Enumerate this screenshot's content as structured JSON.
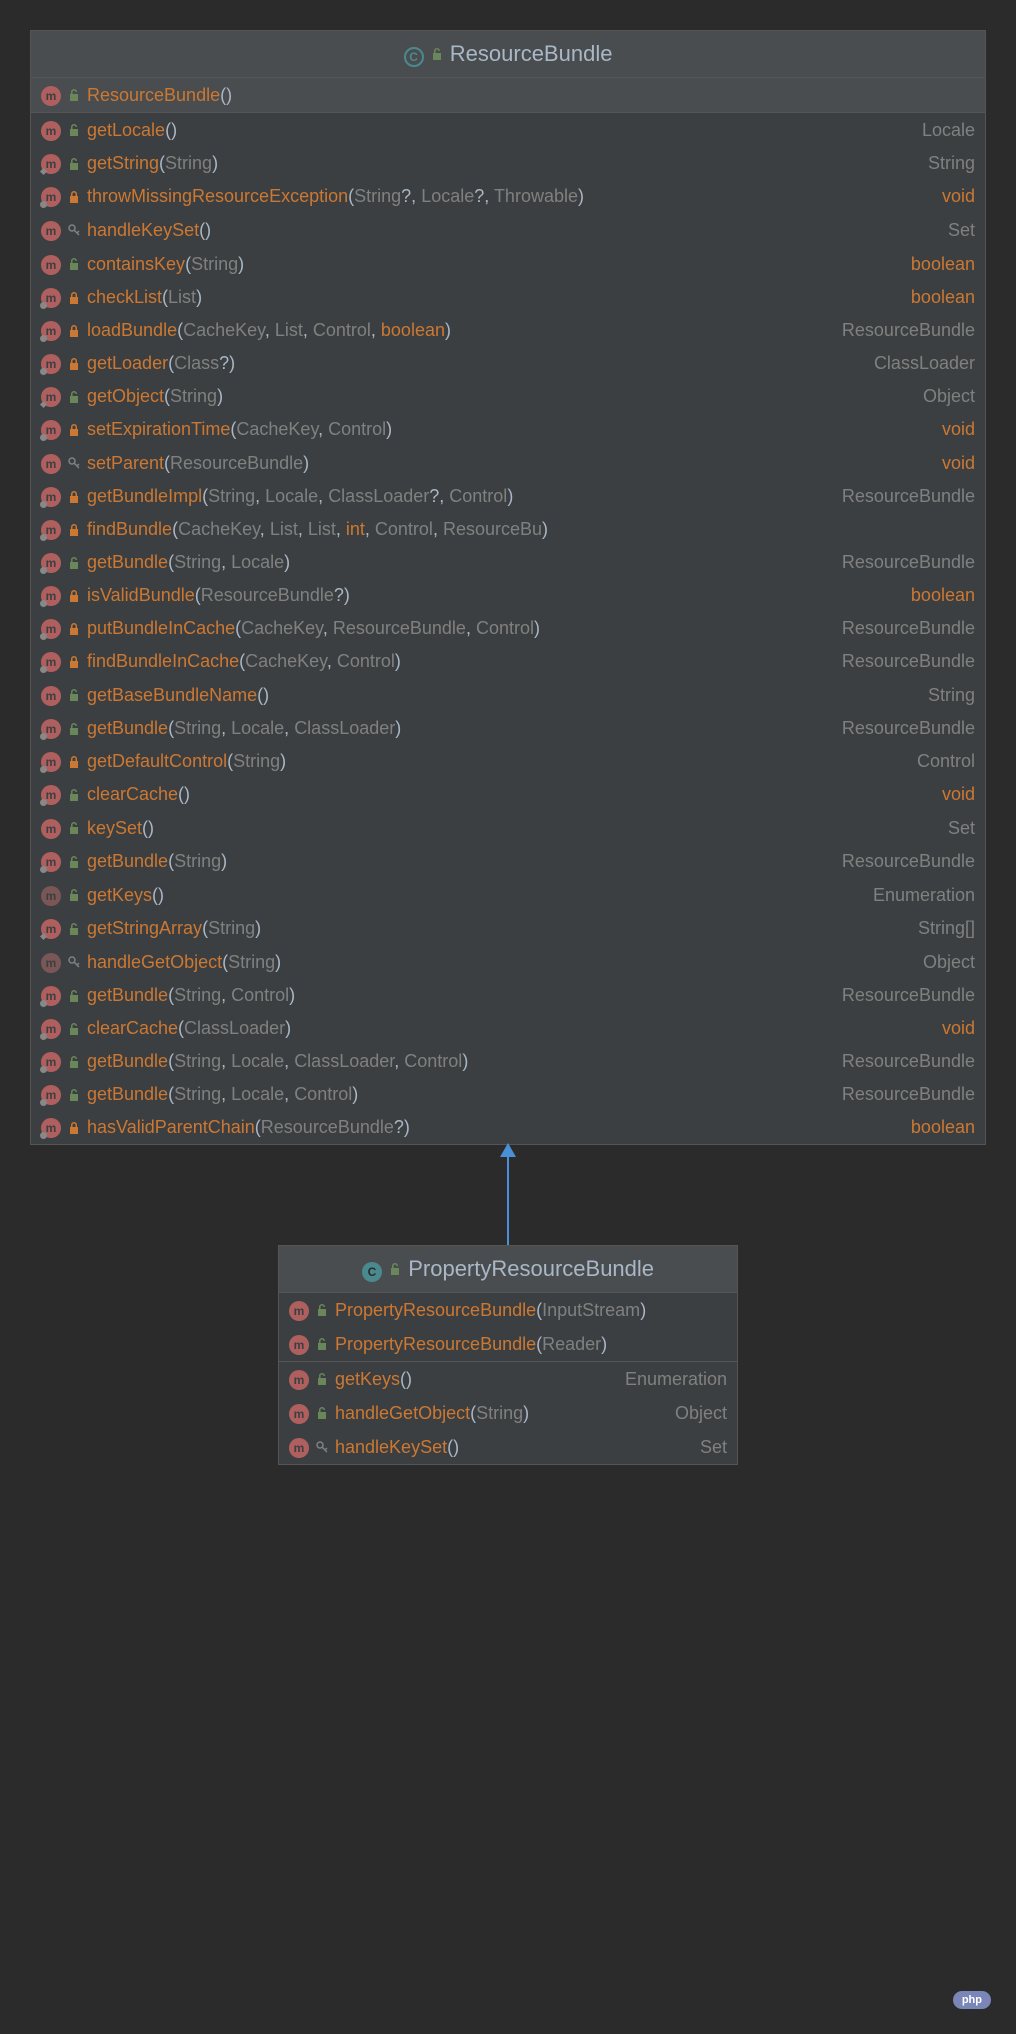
{
  "parent": {
    "title": "ResourceBundle",
    "constructors": [
      {
        "badge": "m",
        "mod": "unlock",
        "static": false,
        "name": "ResourceBundle",
        "params": [],
        "ret": "",
        "highlighted": true
      }
    ],
    "methods": [
      {
        "badge": "m",
        "mod": "unlock",
        "static": false,
        "name": "getLocale",
        "params": [],
        "ret": "Locale",
        "retKw": false
      },
      {
        "badge": "m",
        "mod": "unlock",
        "static": false,
        "final": true,
        "name": "getString",
        "params": [
          {
            "t": "String"
          }
        ],
        "ret": "String",
        "retKw": false
      },
      {
        "badge": "m",
        "mod": "lock",
        "static": true,
        "name": "throwMissingResourceException",
        "params": [
          {
            "t": "String",
            "q": true
          },
          {
            "t": "Locale",
            "q": true
          },
          {
            "t": "Throwable"
          }
        ],
        "ret": "void",
        "retKw": true
      },
      {
        "badge": "m",
        "mod": "key",
        "static": false,
        "name": "handleKeySet",
        "params": [],
        "ret": "Set<String>",
        "retKw": false
      },
      {
        "badge": "m",
        "mod": "unlock",
        "static": false,
        "name": "containsKey",
        "params": [
          {
            "t": "String"
          }
        ],
        "ret": "boolean",
        "retKw": true
      },
      {
        "badge": "m",
        "mod": "lock",
        "static": true,
        "name": "checkList",
        "params": [
          {
            "t": "List<?>"
          }
        ],
        "ret": "boolean",
        "retKw": true
      },
      {
        "badge": "m",
        "mod": "lock",
        "static": true,
        "name": "loadBundle",
        "params": [
          {
            "t": "CacheKey"
          },
          {
            "t": "List<String>"
          },
          {
            "t": "Control"
          },
          {
            "t": "boolean",
            "kw": true
          }
        ],
        "ret": "ResourceBundle",
        "retKw": false
      },
      {
        "badge": "m",
        "mod": "lock",
        "static": true,
        "name": "getLoader",
        "params": [
          {
            "t": "Class<?>",
            "q": true
          }
        ],
        "ret": "ClassLoader",
        "retKw": false
      },
      {
        "badge": "m",
        "mod": "unlock",
        "static": false,
        "final": true,
        "name": "getObject",
        "params": [
          {
            "t": "String"
          }
        ],
        "ret": "Object",
        "retKw": false
      },
      {
        "badge": "m",
        "mod": "lock",
        "static": true,
        "name": "setExpirationTime",
        "params": [
          {
            "t": "CacheKey"
          },
          {
            "t": "Control"
          }
        ],
        "ret": "void",
        "retKw": true
      },
      {
        "badge": "m",
        "mod": "key",
        "static": false,
        "name": "setParent",
        "params": [
          {
            "t": "ResourceBundle"
          }
        ],
        "ret": "void",
        "retKw": true
      },
      {
        "badge": "m",
        "mod": "lock",
        "static": true,
        "name": "getBundleImpl",
        "params": [
          {
            "t": "String"
          },
          {
            "t": "Locale"
          },
          {
            "t": "ClassLoader",
            "q": true
          },
          {
            "t": "Control"
          }
        ],
        "ret": "ResourceBundle",
        "retKw": false
      },
      {
        "badge": "m",
        "mod": "lock",
        "static": true,
        "name": "findBundle",
        "params": [
          {
            "t": "CacheKey"
          },
          {
            "t": "List<Locale>"
          },
          {
            "t": "List<String>"
          },
          {
            "t": "int",
            "kw": true
          },
          {
            "t": "Control"
          },
          {
            "t": "ResourceBu"
          }
        ],
        "ret": "",
        "retKw": false
      },
      {
        "badge": "m",
        "mod": "unlock",
        "static": true,
        "name": "getBundle",
        "params": [
          {
            "t": "String"
          },
          {
            "t": "Locale"
          }
        ],
        "ret": "ResourceBundle",
        "retKw": false
      },
      {
        "badge": "m",
        "mod": "lock",
        "static": true,
        "name": "isValidBundle",
        "params": [
          {
            "t": "ResourceBundle",
            "q": true
          }
        ],
        "ret": "boolean",
        "retKw": true
      },
      {
        "badge": "m",
        "mod": "lock",
        "static": true,
        "name": "putBundleInCache",
        "params": [
          {
            "t": "CacheKey"
          },
          {
            "t": "ResourceBundle"
          },
          {
            "t": "Control"
          }
        ],
        "ret": "ResourceBundle",
        "retKw": false
      },
      {
        "badge": "m",
        "mod": "lock",
        "static": true,
        "name": "findBundleInCache",
        "params": [
          {
            "t": "CacheKey"
          },
          {
            "t": "Control"
          }
        ],
        "ret": "ResourceBundle",
        "retKw": false
      },
      {
        "badge": "m",
        "mod": "unlock",
        "static": false,
        "name": "getBaseBundleName",
        "params": [],
        "ret": "String",
        "retKw": false
      },
      {
        "badge": "m",
        "mod": "unlock",
        "static": true,
        "name": "getBundle",
        "params": [
          {
            "t": "String"
          },
          {
            "t": "Locale"
          },
          {
            "t": "ClassLoader"
          }
        ],
        "ret": "ResourceBundle",
        "retKw": false
      },
      {
        "badge": "m",
        "mod": "lock",
        "static": true,
        "name": "getDefaultControl",
        "params": [
          {
            "t": "String"
          }
        ],
        "ret": "Control",
        "retKw": false
      },
      {
        "badge": "m",
        "mod": "unlock",
        "static": true,
        "name": "clearCache",
        "params": [],
        "ret": "void",
        "retKw": true
      },
      {
        "badge": "m",
        "mod": "unlock",
        "static": false,
        "name": "keySet",
        "params": [],
        "ret": "Set<String>",
        "retKw": false
      },
      {
        "badge": "m",
        "mod": "unlock",
        "static": true,
        "name": "getBundle",
        "params": [
          {
            "t": "String"
          }
        ],
        "ret": "ResourceBundle",
        "retKw": false
      },
      {
        "badge": "m",
        "ab": true,
        "mod": "unlock",
        "static": false,
        "name": "getKeys",
        "params": [],
        "ret": "Enumeration<String>",
        "retKw": false
      },
      {
        "badge": "m",
        "mod": "unlock",
        "static": false,
        "final": true,
        "name": "getStringArray",
        "params": [
          {
            "t": "String"
          }
        ],
        "ret": "String[]",
        "retKw": false
      },
      {
        "badge": "m",
        "ab": true,
        "mod": "key",
        "static": false,
        "name": "handleGetObject",
        "params": [
          {
            "t": "String"
          }
        ],
        "ret": "Object",
        "retKw": false
      },
      {
        "badge": "m",
        "mod": "unlock",
        "static": true,
        "name": "getBundle",
        "params": [
          {
            "t": "String"
          },
          {
            "t": "Control"
          }
        ],
        "ret": "ResourceBundle",
        "retKw": false
      },
      {
        "badge": "m",
        "mod": "unlock",
        "static": true,
        "name": "clearCache",
        "params": [
          {
            "t": "ClassLoader"
          }
        ],
        "ret": "void",
        "retKw": true
      },
      {
        "badge": "m",
        "mod": "unlock",
        "static": true,
        "name": "getBundle",
        "params": [
          {
            "t": "String"
          },
          {
            "t": "Locale"
          },
          {
            "t": "ClassLoader"
          },
          {
            "t": "Control"
          }
        ],
        "ret": "ResourceBundle",
        "retKw": false
      },
      {
        "badge": "m",
        "mod": "unlock",
        "static": true,
        "name": "getBundle",
        "params": [
          {
            "t": "String"
          },
          {
            "t": "Locale"
          },
          {
            "t": "Control"
          }
        ],
        "ret": "ResourceBundle",
        "retKw": false
      },
      {
        "badge": "m",
        "mod": "lock",
        "static": true,
        "name": "hasValidParentChain",
        "params": [
          {
            "t": "ResourceBundle",
            "q": true
          }
        ],
        "ret": "boolean",
        "retKw": true
      }
    ]
  },
  "child": {
    "title": "PropertyResourceBundle",
    "constructors": [
      {
        "badge": "m",
        "mod": "unlock",
        "static": false,
        "name": "PropertyResourceBundle",
        "params": [
          {
            "t": "InputStream"
          }
        ],
        "ret": ""
      },
      {
        "badge": "m",
        "mod": "unlock",
        "static": false,
        "name": "PropertyResourceBundle",
        "params": [
          {
            "t": "Reader"
          }
        ],
        "ret": ""
      }
    ],
    "methods": [
      {
        "badge": "m",
        "mod": "unlock",
        "static": false,
        "name": "getKeys",
        "params": [],
        "ret": "Enumeration<String>",
        "retKw": false
      },
      {
        "badge": "m",
        "mod": "unlock",
        "static": false,
        "name": "handleGetObject",
        "params": [
          {
            "t": "String"
          }
        ],
        "ret": "Object",
        "retKw": false
      },
      {
        "badge": "m",
        "mod": "key",
        "static": false,
        "name": "handleKeySet",
        "params": [],
        "ret": "Set<String>",
        "retKw": false
      }
    ]
  },
  "watermark": "php"
}
